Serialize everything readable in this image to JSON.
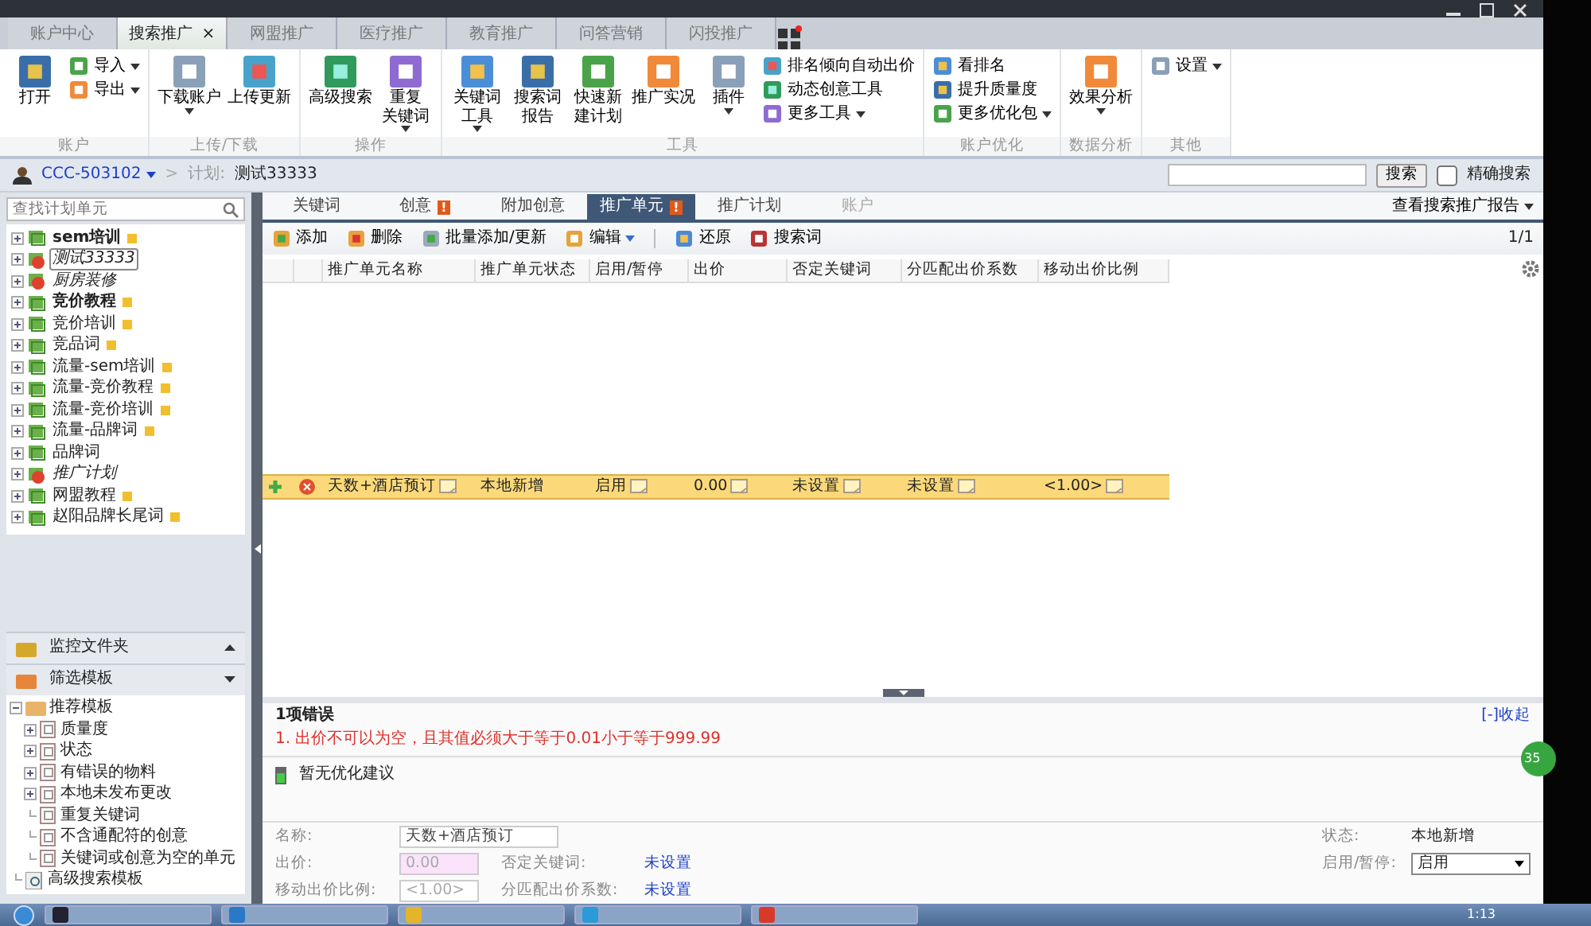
{
  "top_tabs": [
    {
      "label": "账户中心",
      "selected": false,
      "closable": false
    },
    {
      "label": "搜索推广",
      "selected": true,
      "closable": true
    },
    {
      "label": "网盟推广",
      "selected": false,
      "closable": false
    },
    {
      "label": "医疗推广",
      "selected": false,
      "closable": false
    },
    {
      "label": "教育推广",
      "selected": false,
      "closable": false
    },
    {
      "label": "问答营销",
      "selected": false,
      "closable": false
    },
    {
      "label": "闪投推广",
      "selected": false,
      "closable": false
    }
  ],
  "close_mark": "×",
  "ribbon": [
    {
      "label": "账户",
      "items": [
        {
          "kind": "large",
          "lines": [
            "打开"
          ],
          "dropdown": false
        },
        {
          "kind": "stack",
          "items": [
            {
              "label": "导入",
              "dropdown": true
            },
            {
              "label": "导出",
              "dropdown": true
            }
          ]
        }
      ]
    },
    {
      "label": "上传/下载",
      "items": [
        {
          "kind": "large",
          "lines": [
            "下载账户"
          ],
          "dropdown": true
        },
        {
          "kind": "large",
          "lines": [
            "上传更新"
          ],
          "dropdown": false
        }
      ]
    },
    {
      "label": "操作",
      "items": [
        {
          "kind": "large",
          "lines": [
            "高级搜索"
          ],
          "dropdown": false
        },
        {
          "kind": "large",
          "lines": [
            "重复",
            "关键词"
          ],
          "dropdown": true
        }
      ]
    },
    {
      "label": "工具",
      "items": [
        {
          "kind": "large",
          "lines": [
            "关键词",
            "工具"
          ],
          "dropdown": true
        },
        {
          "kind": "large",
          "lines": [
            "搜索词",
            "报告"
          ],
          "dropdown": false
        },
        {
          "kind": "large",
          "lines": [
            "快速新",
            "建计划"
          ],
          "dropdown": false
        },
        {
          "kind": "large",
          "lines": [
            "推广实况"
          ],
          "dropdown": false
        },
        {
          "kind": "large",
          "lines": [
            "插件"
          ],
          "dropdown": true
        },
        {
          "kind": "stack",
          "items": [
            {
              "label": "排名倾向自动出价",
              "dropdown": false
            },
            {
              "label": "动态创意工具",
              "dropdown": false
            },
            {
              "label": "更多工具",
              "dropdown": true
            }
          ]
        }
      ]
    },
    {
      "label": "账户优化",
      "items": [
        {
          "kind": "stack",
          "items": [
            {
              "label": "看排名",
              "dropdown": false
            },
            {
              "label": "提升质量度",
              "dropdown": false
            },
            {
              "label": "更多优化包",
              "dropdown": true
            }
          ]
        }
      ]
    },
    {
      "label": "数据分析",
      "items": [
        {
          "kind": "large",
          "lines": [
            "效果分析"
          ],
          "dropdown": true
        }
      ]
    },
    {
      "label": "其他",
      "items": [
        {
          "kind": "stack",
          "items": [
            {
              "label": "设置",
              "dropdown": true
            }
          ]
        }
      ]
    }
  ],
  "breadcrumb": {
    "account": "CCC-503102",
    "separator": ">",
    "plan_label": "计划:",
    "plan": "测试33333"
  },
  "search": {
    "button": "搜索",
    "exact": {
      "label": "精确搜索",
      "checked": false
    }
  },
  "plan_search": {
    "placeholder": "查找计划单元"
  },
  "plans": [
    {
      "name": "sem培训",
      "paused": false,
      "bold": true,
      "flag": true,
      "selected": false
    },
    {
      "name": "测试33333",
      "paused": true,
      "bold": false,
      "flag": false,
      "selected": true
    },
    {
      "name": "厨房装修",
      "paused": true,
      "bold": false,
      "flag": false,
      "selected": false
    },
    {
      "name": "竞价教程",
      "paused": false,
      "bold": true,
      "flag": true,
      "selected": false
    },
    {
      "name": "竞价培训",
      "paused": false,
      "bold": false,
      "flag": true,
      "selected": false
    },
    {
      "name": "竞品词",
      "paused": false,
      "bold": false,
      "flag": true,
      "selected": false
    },
    {
      "name": "流量-sem培训",
      "paused": false,
      "bold": false,
      "flag": true,
      "selected": false
    },
    {
      "name": "流量-竞价教程",
      "paused": false,
      "bold": false,
      "flag": true,
      "selected": false
    },
    {
      "name": "流量-竞价培训",
      "paused": false,
      "bold": false,
      "flag": true,
      "selected": false
    },
    {
      "name": "流量-品牌词",
      "paused": false,
      "bold": false,
      "flag": true,
      "selected": false
    },
    {
      "name": "品牌词",
      "paused": false,
      "bold": false,
      "flag": false,
      "selected": false
    },
    {
      "name": "推广计划",
      "paused": true,
      "bold": false,
      "flag": false,
      "selected": false
    },
    {
      "name": "网盟教程",
      "paused": false,
      "bold": false,
      "flag": true,
      "selected": false
    },
    {
      "name": "赵阳品牌长尾词",
      "paused": false,
      "bold": false,
      "flag": true,
      "selected": false
    }
  ],
  "side_panels": [
    {
      "label": "监控文件夹",
      "expanded": false
    },
    {
      "label": "筛选模板",
      "expanded": true
    }
  ],
  "filter_tree": [
    {
      "label": "推荐模板",
      "kind": "folder",
      "expanded": true,
      "children": [
        {
          "label": "质量度",
          "kind": "template",
          "expanded": false
        },
        {
          "label": "状态",
          "kind": "template",
          "expanded": false
        },
        {
          "label": "有错误的物料",
          "kind": "template",
          "expanded": false
        },
        {
          "label": "本地未发布更改",
          "kind": "template",
          "expanded": false
        },
        {
          "label": "重复关键词",
          "kind": "template"
        },
        {
          "label": "不含通配符的创意",
          "kind": "template"
        },
        {
          "label": "关键词或创意为空的单元",
          "kind": "template"
        }
      ]
    },
    {
      "label": "高级搜索模板",
      "kind": "search"
    }
  ],
  "main_tabs": [
    {
      "label": "关键词",
      "selected": false,
      "alert": false,
      "disabled": false
    },
    {
      "label": "创意",
      "selected": false,
      "alert": true,
      "disabled": false
    },
    {
      "label": "附加创意",
      "selected": false,
      "alert": false,
      "disabled": false
    },
    {
      "label": "推广单元",
      "selected": true,
      "alert": true,
      "disabled": false
    },
    {
      "label": "推广计划",
      "selected": false,
      "alert": false,
      "disabled": false
    },
    {
      "label": "账户",
      "selected": false,
      "alert": false,
      "disabled": true
    }
  ],
  "alert_mark": "!",
  "report_link": "查看搜索推广报告",
  "toolbar": [
    {
      "kind": "button",
      "label": "添加"
    },
    {
      "kind": "button",
      "label": "删除"
    },
    {
      "kind": "button",
      "label": "批量添加/更新"
    },
    {
      "kind": "dropdown",
      "label": "编辑"
    },
    {
      "kind": "separator"
    },
    {
      "kind": "button",
      "label": "还原"
    },
    {
      "kind": "button",
      "label": "搜索词"
    }
  ],
  "page": "1/1",
  "table": {
    "columns": [
      "推广单元名称",
      "推广单元状态",
      "启用/暂停",
      "出价",
      "否定关键词",
      "分匹配出价系数",
      "移动出价比例"
    ],
    "rows": [
      {
        "selected": true,
        "error": true,
        "cells": [
          {
            "text": "天数+酒店预订",
            "editable": true
          },
          {
            "text": "本地新增",
            "editable": false
          },
          {
            "text": "启用",
            "editable": true
          },
          {
            "text": "0.00",
            "editable": true
          },
          {
            "text": "未设置",
            "editable": true
          },
          {
            "text": "未设置",
            "editable": true
          },
          {
            "text": "<1.00>",
            "editable": true
          }
        ]
      }
    ]
  },
  "errors": {
    "title": "1项错误",
    "collapse": "[-]收起",
    "items": [
      "1. 出价不可以为空，且其值必须大于等于0.01小于等于999.99"
    ]
  },
  "suggestion": "暂无优化建议",
  "details": [
    {
      "left": [
        {
          "label": "名称:",
          "value": "天数+酒店预订",
          "kind": "input",
          "invalid": false,
          "wide": true
        }
      ],
      "right": {
        "label": "状态:",
        "value": "本地新增",
        "kind": "text"
      }
    },
    {
      "left": [
        {
          "label": "出价:",
          "placeholder": "0.00",
          "kind": "input",
          "invalid": true,
          "wide": false
        },
        {
          "label": "否定关键词:",
          "value": "未设置",
          "kind": "link"
        }
      ],
      "right": {
        "label": "启用/暂停:",
        "value": "启用",
        "kind": "select"
      }
    },
    {
      "left": [
        {
          "label": "移动出价比例:",
          "placeholder": "<1.00>",
          "kind": "input",
          "invalid": false,
          "wide": false
        },
        {
          "label": "分匹配出价系数:",
          "value": "未设置",
          "kind": "link"
        }
      ]
    }
  ],
  "badge": "35",
  "clock": "1:13"
}
